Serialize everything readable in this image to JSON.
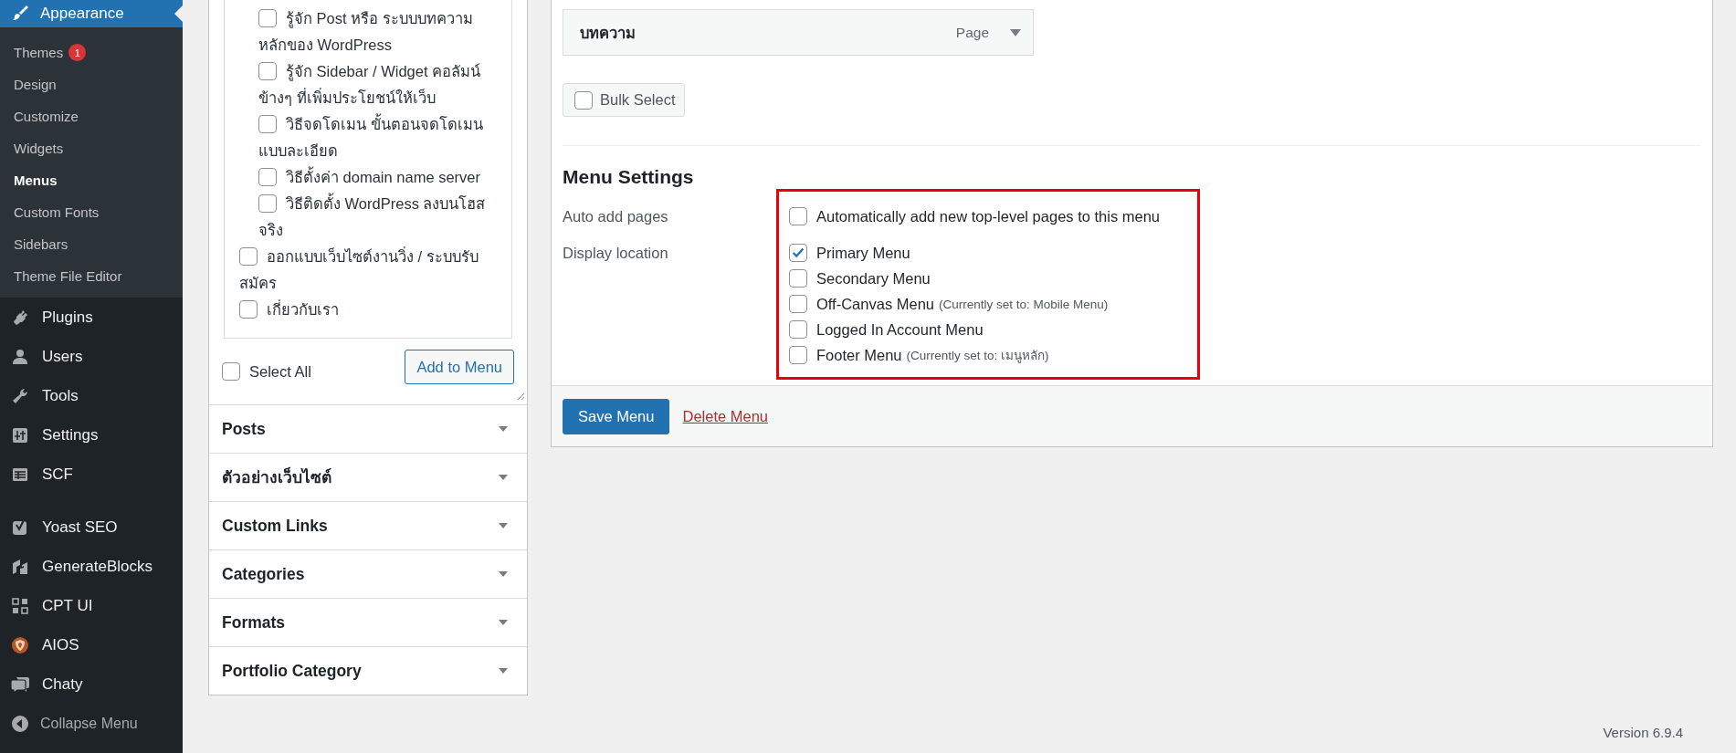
{
  "sidebar": {
    "current": {
      "label": "Appearance",
      "selected": true
    },
    "submenu": [
      {
        "label": "Themes",
        "selected": false,
        "badge": "1"
      },
      {
        "label": "Design",
        "selected": false
      },
      {
        "label": "Customize",
        "selected": false
      },
      {
        "label": "Widgets",
        "selected": false
      },
      {
        "label": "Menus",
        "selected": true
      },
      {
        "label": "Custom Fonts",
        "selected": false
      },
      {
        "label": "Sidebars",
        "selected": false
      },
      {
        "label": "Theme File Editor",
        "selected": false
      }
    ],
    "menu_groups": [
      {
        "items": [
          {
            "label": "Plugins"
          },
          {
            "label": "Users"
          },
          {
            "label": "Tools"
          },
          {
            "label": "Settings"
          },
          {
            "label": "SCF"
          }
        ]
      },
      {
        "items": [
          {
            "label": "Yoast SEO"
          },
          {
            "label": "GenerateBlocks"
          },
          {
            "label": "CPT UI"
          },
          {
            "label": "AIOS"
          },
          {
            "label": "Chaty"
          }
        ]
      }
    ],
    "collapse": "Collapse Menu"
  },
  "page_list": {
    "items": [
      {
        "children": [
          {
            "label": "รู้จัก Post หรือ ระบบบทความหลักของ WordPress",
            "checked": false
          },
          {
            "label": "รู้จัก Sidebar / Widget คอลัมน์ข้างๆ ที่เพิ่มประโยชน์ให้เว็บ",
            "checked": false
          },
          {
            "label": "วิธีจดโดเมน ขั้นตอนจดโดเมน แบบละเอียด",
            "checked": false
          },
          {
            "label": "วิธีตั้งค่า domain name server",
            "checked": false
          },
          {
            "label": "วิธีติดตั้ง WordPress ลงบนโฮสจริง",
            "checked": false
          }
        ]
      },
      {
        "label": "ออกแบบเว็บไซต์งานวิ่ง / ระบบรับสมัคร",
        "checked": false
      },
      {
        "label": "เกี่ยวกับเรา",
        "checked": false
      }
    ],
    "select_all": {
      "label": "Select All",
      "checked": false
    },
    "add_button": "Add to Menu"
  },
  "sections": [
    {
      "label": "Posts",
      "expanded": false
    },
    {
      "label": "ตัวอย่างเว็บไซต์",
      "expanded": false
    },
    {
      "label": "Custom Links",
      "expanded": false
    },
    {
      "label": "Categories",
      "expanded": false
    },
    {
      "label": "Formats",
      "expanded": false
    },
    {
      "label": "Portfolio Category",
      "expanded": false
    }
  ],
  "menu_item": {
    "title": "บทความ",
    "type": "Page",
    "expanded": false
  },
  "bulk_select": {
    "label": "Bulk Select",
    "checked": false
  },
  "menu_settings": {
    "heading": "Menu Settings",
    "highlighted": true,
    "auto_add": {
      "label": "Auto add pages",
      "option": {
        "label": "Automatically add new top-level pages to this menu",
        "checked": false
      }
    },
    "display_location": {
      "label": "Display location",
      "options": [
        {
          "label": "Primary Menu",
          "checked": true
        },
        {
          "label": "Secondary Menu",
          "checked": false
        },
        {
          "label": "Off-Canvas Menu",
          "note": "(Currently set to: Mobile Menu)",
          "checked": false
        },
        {
          "label": "Logged In Account Menu",
          "checked": false
        },
        {
          "label": "Footer Menu",
          "note": "(Currently set to: เมนูหลัก)",
          "checked": false
        }
      ]
    }
  },
  "save_button": "Save Menu",
  "delete_link": "Delete Menu",
  "version": "Version 6.9.4"
}
